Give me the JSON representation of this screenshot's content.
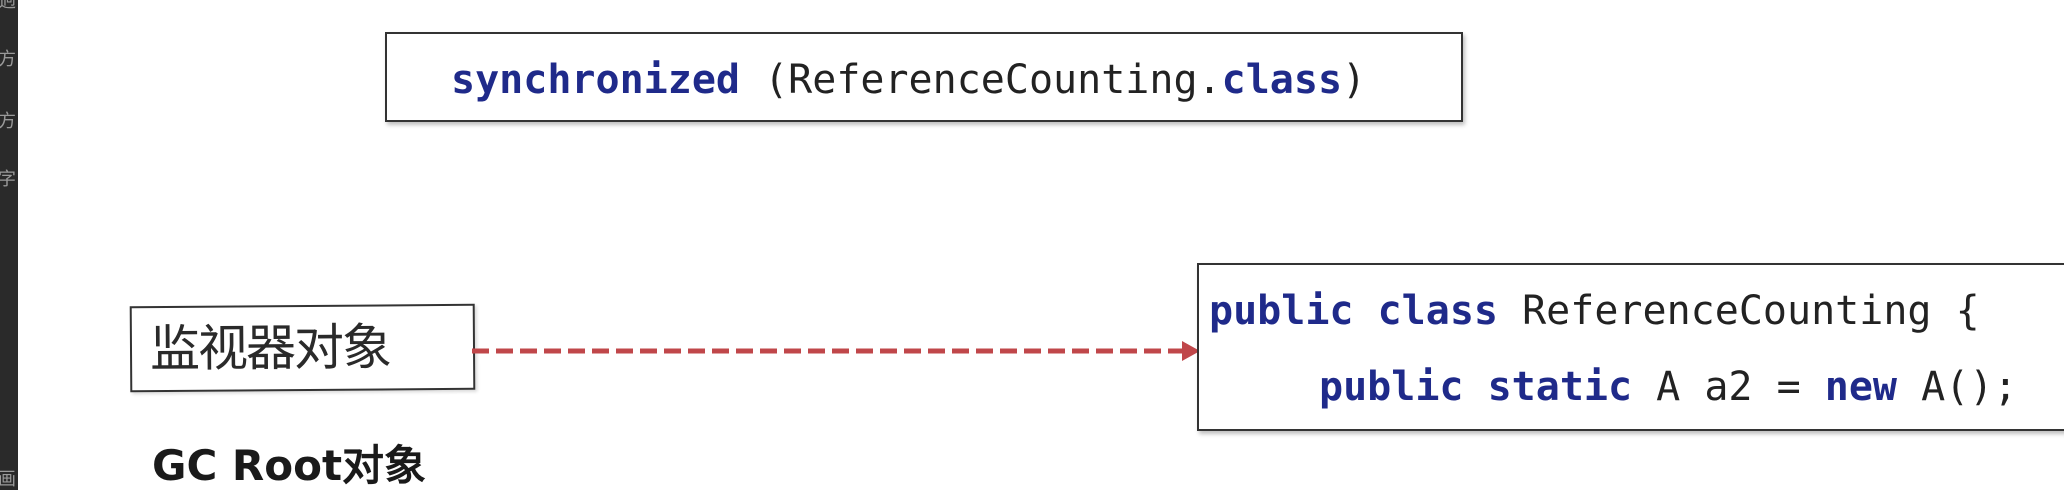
{
  "left_strip": {
    "chars": [
      "逈",
      "方",
      "方",
      "字",
      "画"
    ]
  },
  "top_box": {
    "keyword": "synchronized",
    "args": " (ReferenceCounting.",
    "class_kw": "class",
    "tail": ")"
  },
  "right_box": {
    "line1": {
      "kw1": "public",
      "kw2": "class",
      "rest": " ReferenceCounting {"
    },
    "line2": {
      "kw1": "public",
      "kw2": "static",
      "mid": " A a2 = ",
      "kw3": "new",
      "rest": " A();"
    }
  },
  "monitor": {
    "label": "监视器对象"
  },
  "gc_root": {
    "label": "GC Root对象"
  },
  "colors": {
    "arrow": "#c0474a",
    "keyword": "#1f2a8a"
  }
}
